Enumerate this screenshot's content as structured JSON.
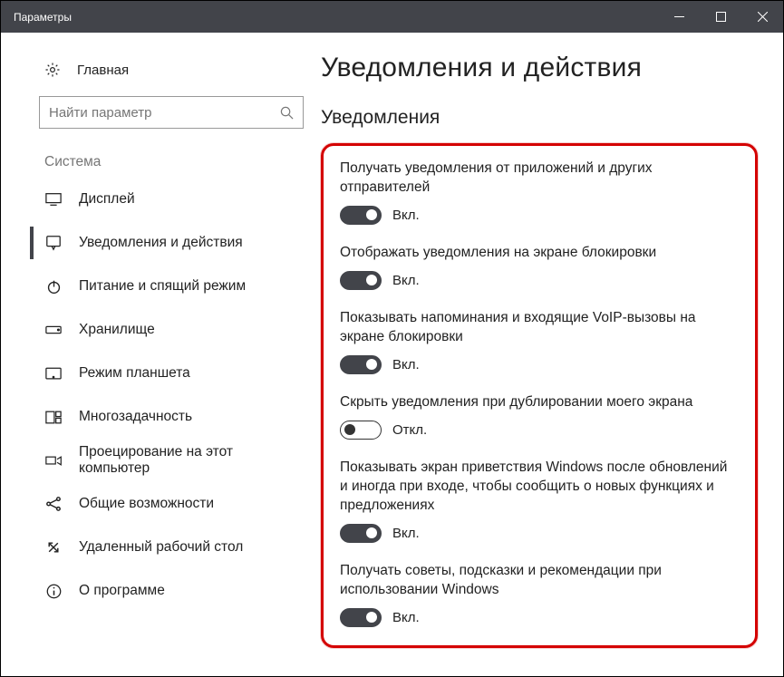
{
  "window": {
    "title": "Параметры"
  },
  "sidebar": {
    "home": "Главная",
    "search_placeholder": "Найти параметр",
    "section": "Система",
    "items": [
      {
        "label": "Дисплей"
      },
      {
        "label": "Уведомления и действия"
      },
      {
        "label": "Питание и спящий режим"
      },
      {
        "label": "Хранилище"
      },
      {
        "label": "Режим планшета"
      },
      {
        "label": "Многозадачность"
      },
      {
        "label": "Проецирование на этот компьютер"
      },
      {
        "label": "Общие возможности"
      },
      {
        "label": "Удаленный рабочий стол"
      },
      {
        "label": "О программе"
      }
    ]
  },
  "content": {
    "heading": "Уведомления и действия",
    "subheading": "Уведомления",
    "state_on": "Вкл.",
    "state_off": "Откл.",
    "settings": [
      {
        "label": "Получать уведомления от приложений и других отправителей",
        "state": "Вкл.",
        "on": true
      },
      {
        "label": "Отображать уведомления на экране блокировки",
        "state": "Вкл.",
        "on": true
      },
      {
        "label": "Показывать напоминания и входящие VoIP-вызовы на экране блокировки",
        "state": "Вкл.",
        "on": true
      },
      {
        "label": "Скрыть уведомления при дублировании моего экрана",
        "state": "Откл.",
        "on": false
      },
      {
        "label": "Показывать экран приветствия Windows после обновлений и иногда при входе, чтобы сообщить о новых функциях и предложениях",
        "state": "Вкл.",
        "on": true
      },
      {
        "label": "Получать советы, подсказки и рекомендации при использовании Windows",
        "state": "Вкл.",
        "on": true
      }
    ]
  }
}
